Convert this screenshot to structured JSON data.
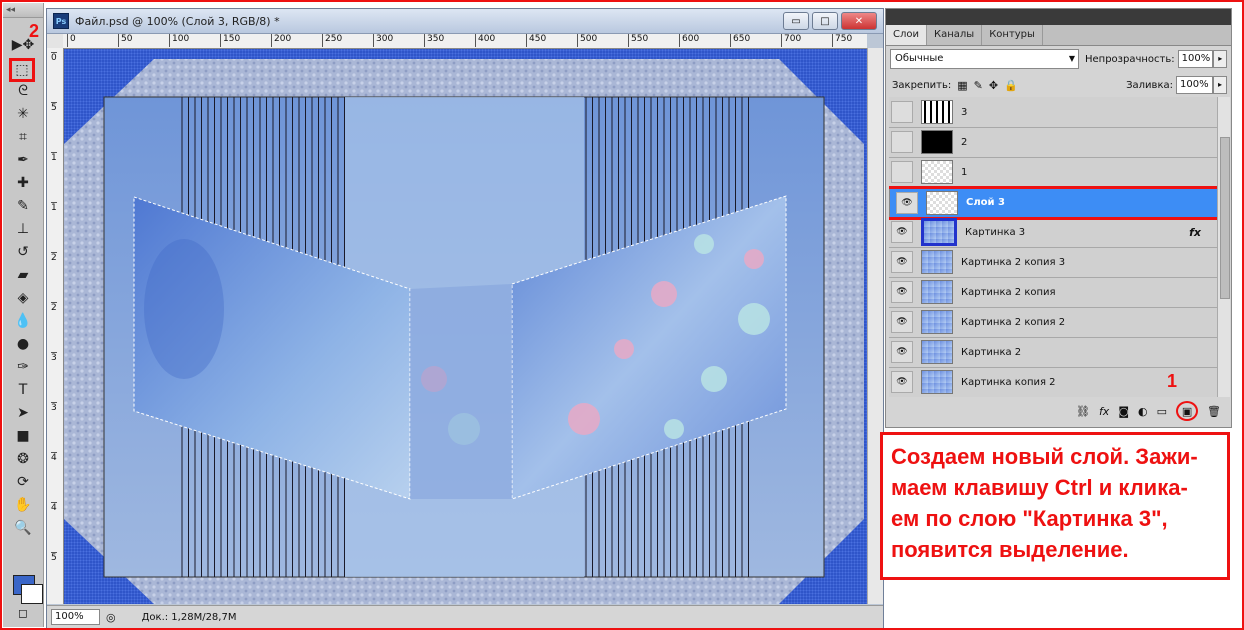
{
  "document": {
    "title": "Файл.psd @ 100% (Слой 3, RGB/8) *",
    "ruler_top_ticks": [
      "0",
      "50",
      "100",
      "150",
      "200",
      "250",
      "300",
      "350",
      "400",
      "450",
      "500",
      "550",
      "600",
      "650",
      "700",
      "750"
    ],
    "ruler_left_ticks": [
      "0",
      "5",
      "1",
      "1",
      "2",
      "2",
      "3",
      "3",
      "4",
      "4",
      "5"
    ],
    "zoom": "100%",
    "doc_info": "Док.: 1,28M/28,7M",
    "window_buttons": {
      "minimize": "▭",
      "maximize": "□",
      "close": "✕"
    }
  },
  "toolbar": {
    "grip": "◂◂",
    "annotation_number": "2",
    "tools": [
      {
        "icon": "move-tool-icon",
        "glyph": "▶✥"
      },
      {
        "icon": "marquee-tool-icon",
        "glyph": "⬚"
      },
      {
        "icon": "lasso-tool-icon",
        "glyph": "ᘓ"
      },
      {
        "icon": "magic-wand-tool-icon",
        "glyph": "✳"
      },
      {
        "icon": "crop-tool-icon",
        "glyph": "⌗"
      },
      {
        "icon": "eyedropper-tool-icon",
        "glyph": "✒"
      },
      {
        "icon": "healing-brush-tool-icon",
        "glyph": "✚"
      },
      {
        "icon": "brush-tool-icon",
        "glyph": "✎"
      },
      {
        "icon": "clone-stamp-tool-icon",
        "glyph": "⊥"
      },
      {
        "icon": "history-brush-tool-icon",
        "glyph": "↺"
      },
      {
        "icon": "eraser-tool-icon",
        "glyph": "▰"
      },
      {
        "icon": "paint-bucket-tool-icon",
        "glyph": "◈"
      },
      {
        "icon": "blur-tool-icon",
        "glyph": "💧"
      },
      {
        "icon": "dodge-tool-icon",
        "glyph": "●"
      },
      {
        "icon": "pen-tool-icon",
        "glyph": "✑"
      },
      {
        "icon": "type-tool-icon",
        "glyph": "T"
      },
      {
        "icon": "path-selection-tool-icon",
        "glyph": "➤"
      },
      {
        "icon": "shape-tool-icon",
        "glyph": "■"
      },
      {
        "icon": "3d-rotate-tool-icon",
        "glyph": "❂"
      },
      {
        "icon": "3d-orbit-tool-icon",
        "glyph": "⟳"
      },
      {
        "icon": "hand-tool-icon",
        "glyph": "✋"
      },
      {
        "icon": "zoom-tool-icon",
        "glyph": "🔍"
      }
    ],
    "quick_mask_glyph": "◻"
  },
  "layers_panel": {
    "tabs": [
      "Слои",
      "Каналы",
      "Контуры"
    ],
    "blend_mode": "Обычные",
    "opacity_label": "Непрозрачность:",
    "opacity_value": "100%",
    "lock_label": "Закрепить:",
    "fill_label": "Заливка:",
    "fill_value": "100%",
    "layers": [
      {
        "name": "3",
        "visible": false,
        "thumb": "mask-3"
      },
      {
        "name": "2",
        "visible": false,
        "thumb": "mask-2"
      },
      {
        "name": "1",
        "visible": false,
        "thumb": "mask-1"
      },
      {
        "name": "Слой 3",
        "visible": true,
        "selected": true,
        "thumb": "transparent"
      },
      {
        "name": "Картинка 3",
        "visible": true,
        "fx": "fx",
        "thumb": "image"
      },
      {
        "name": "Картинка 2 копия 3",
        "visible": true,
        "thumb": "image"
      },
      {
        "name": "Картинка 2 копия",
        "visible": true,
        "thumb": "image"
      },
      {
        "name": "Картинка 2 копия 2",
        "visible": true,
        "thumb": "image"
      },
      {
        "name": "Картинка 2",
        "visible": true,
        "thumb": "image"
      },
      {
        "name": "Картинка копия 2",
        "visible": true,
        "thumb": "image"
      }
    ],
    "annotation_number": "1",
    "bottom_icons": [
      "link-icon",
      "fx-icon",
      "mask-icon",
      "adjustment-icon",
      "group-icon",
      "new-layer-icon",
      "trash-icon"
    ]
  },
  "instruction": {
    "lines": [
      "Создаем новый слой. Зажи-",
      "маем клавишу Ctrl и клика-",
      "ем по слою \"Картинка 3\",",
      "появится выделение."
    ]
  },
  "colors": {
    "annotation": "#e11111",
    "selection": "#3d8df5",
    "canvas_blue": "#2f55c9"
  }
}
